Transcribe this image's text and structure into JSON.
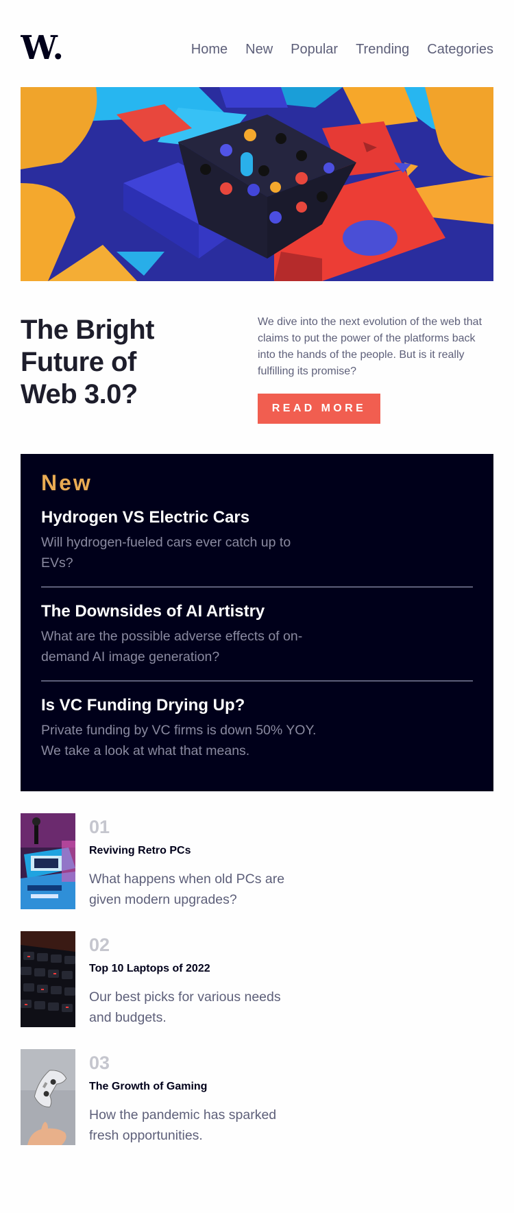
{
  "logo": {
    "text": "W."
  },
  "nav": [
    {
      "label": "Home"
    },
    {
      "label": "New"
    },
    {
      "label": "Popular"
    },
    {
      "label": "Trending"
    },
    {
      "label": "Categories"
    }
  ],
  "hero": {
    "headline_line1": "The Bright",
    "headline_line2": "Future of",
    "headline_line3": "Web 3.0?",
    "description": "We dive into the next evolution of the web that claims to put the power of the platforms back into the hands of the people. But is it really fulfilling its promise?",
    "button_label": "READ MORE"
  },
  "new_section": {
    "title": "New",
    "items": [
      {
        "title": "Hydrogen VS Electric Cars",
        "description": "Will hydrogen-fueled cars ever catch up to EVs?"
      },
      {
        "title": "The Downsides of AI Artistry",
        "description": "What are the possible adverse effects of on-demand AI image generation?"
      },
      {
        "title": "Is VC Funding Drying Up?",
        "description": "Private funding by VC firms is down 50% YOY. We take a look at what that means."
      }
    ]
  },
  "articles": [
    {
      "number": "01",
      "title": "Reviving Retro PCs",
      "description": "What happens when old PCs are given modern upgrades?"
    },
    {
      "number": "02",
      "title": "Top 10 Laptops of 2022",
      "description": "Our best picks for various needs and budgets."
    },
    {
      "number": "03",
      "title": "The Growth of Gaming",
      "description": "How the pandemic has sparked fresh opportunities."
    }
  ],
  "colors": {
    "accent_red": "#f15e50",
    "accent_orange": "#e9ab53",
    "dark_navy": "#00001a",
    "grayish_blue": "#5d5f79"
  }
}
